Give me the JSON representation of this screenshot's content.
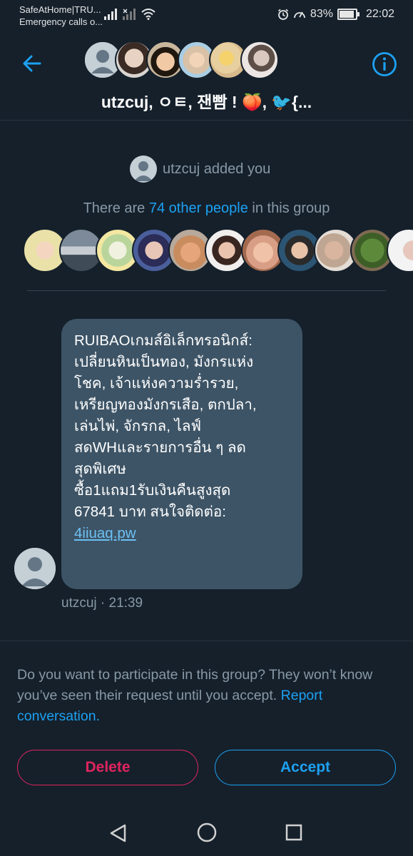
{
  "status_bar": {
    "carrier_line1": "SafeAtHome|TRU...",
    "carrier_line2": "Emergency calls o...",
    "battery": "83%",
    "time": "22:02"
  },
  "header": {
    "group_title": "utzcuj, ㅇㅌ, 잰빰 ! 🍑, 🐦{..."
  },
  "intro": {
    "added_text": "utzcuj added you",
    "others_prefix": "There are ",
    "others_link": "74 other people",
    "others_suffix": " in this group"
  },
  "message": {
    "lines": [
      "RUIBAOเกมส์อิเล็กทรอนิกส์:",
      "เปลี่ยนหินเป็นทอง, มังกรแห่ง",
      "โชค, เจ้าแห่งความร่ำรวย,",
      "เหรียญทองมังกรเสือ, ตกปลา,",
      "เล่นไพ่, จักรกล, ไลฟ์",
      "สดWHและรายการอื่น ๆ ลด",
      "สุดพิเศษ",
      "ซื้อ1แถม1รับเงินคืนสูงสุด",
      "67841 บาท สนใจติดต่อ:"
    ],
    "link": "4iiuaq.pw",
    "meta": "utzcuj · 21:39"
  },
  "prompt": {
    "text": "Do you want to participate in this group? They won’t know you’ve seen their request until you accept.",
    "report": "Report conversation."
  },
  "buttons": {
    "delete": "Delete",
    "accept": "Accept"
  },
  "colors": {
    "background": "#15202b",
    "accent": "#1da1f2",
    "danger": "#e0245e",
    "bubble": "#3d5466",
    "muted": "#8899a6"
  }
}
